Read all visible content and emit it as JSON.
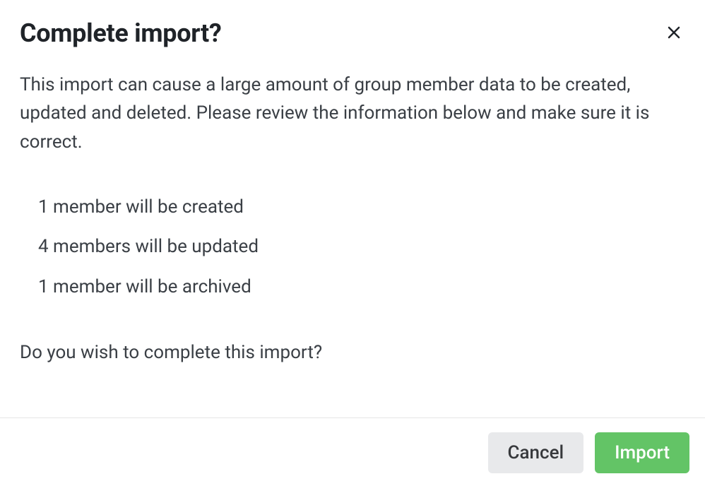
{
  "dialog": {
    "title": "Complete import?",
    "intro": "This import can cause a large amount of group member data to be created, updated and deleted. Please review the information below and make sure it is correct.",
    "summary": {
      "created": "1 member will be created",
      "updated": "4 members will be updated",
      "archived": "1 member will be archived"
    },
    "confirm": "Do you wish to complete this import?",
    "buttons": {
      "cancel": "Cancel",
      "import": "Import"
    }
  }
}
